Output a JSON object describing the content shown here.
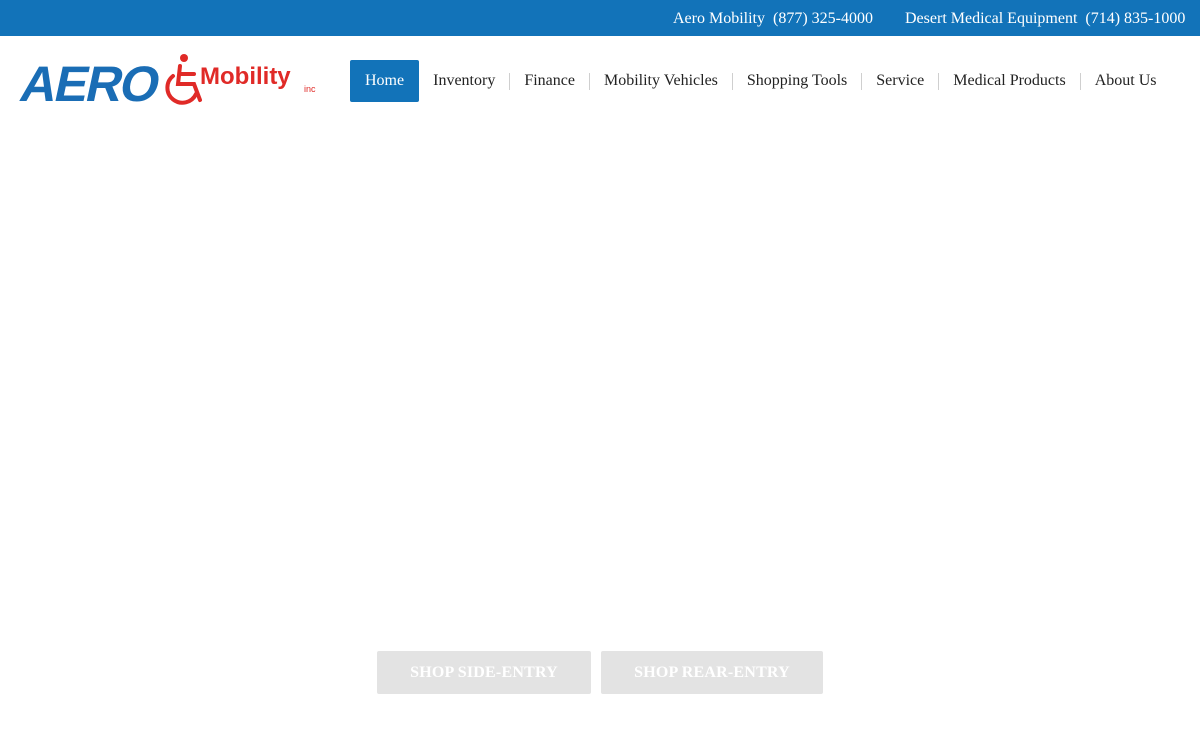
{
  "topbar": {
    "phones": [
      {
        "name": "Aero Mobility",
        "number": "(877) 325-4000"
      },
      {
        "name": "Desert Medical Equipment",
        "number": "(714)  835-1000"
      }
    ]
  },
  "logo": {
    "text_main": "AERO",
    "text_secondary": "Mobility",
    "text_suffix": "inc",
    "colors": {
      "blue": "#1a6db5",
      "red": "#e02a27"
    }
  },
  "nav": {
    "items": [
      {
        "label": "Home",
        "active": true
      },
      {
        "label": "Inventory"
      },
      {
        "label": "Finance"
      },
      {
        "label": "Mobility Vehicles"
      },
      {
        "label": "Shopping Tools"
      },
      {
        "label": "Service"
      },
      {
        "label": "Medical Products"
      },
      {
        "label": "About Us"
      }
    ]
  },
  "hero": {
    "buttons": {
      "side_entry": "SHOP SIDE-ENTRY",
      "rear_entry": "SHOP REAR-ENTRY"
    }
  },
  "colors": {
    "brand_blue": "#1273b9",
    "button_gray": "#e3e3e3"
  }
}
